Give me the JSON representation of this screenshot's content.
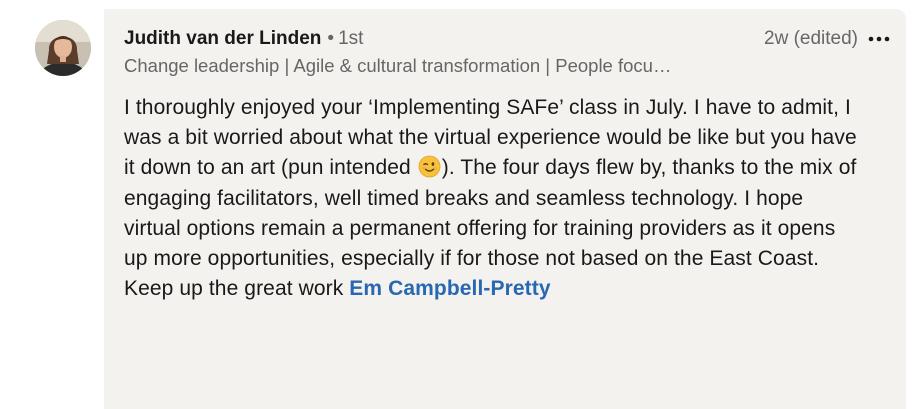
{
  "comment": {
    "author": {
      "name": "Judith van der Linden",
      "separator": "•",
      "degree": "1st",
      "headline": "Change leadership | Agile & cultural transformation | People focu…"
    },
    "timestamp": "2w (edited)",
    "more_icon": "more-horizontal-icon",
    "body": {
      "text_before_emoji": "I thoroughly enjoyed your ‘Implementing SAFe’ class in July. I have to admit, I was a bit worried about what the virtual experience would be like but you have it down to an art (pun intended ",
      "emoji": "winking-face-emoji",
      "text_after_emoji": "). The four days flew by, thanks to the mix of engaging facilitators, well timed breaks and seamless technology. I hope virtual options remain a permanent offering for training providers as it opens up more opportunities, especially if for those not based on the East Coast. Keep up the great work ",
      "mention": "Em Campbell-Pretty"
    }
  },
  "colors": {
    "bubble_background": "#f3f2ef",
    "mention": "#2867b2",
    "text_primary": "#191919",
    "text_secondary": "#666666"
  }
}
